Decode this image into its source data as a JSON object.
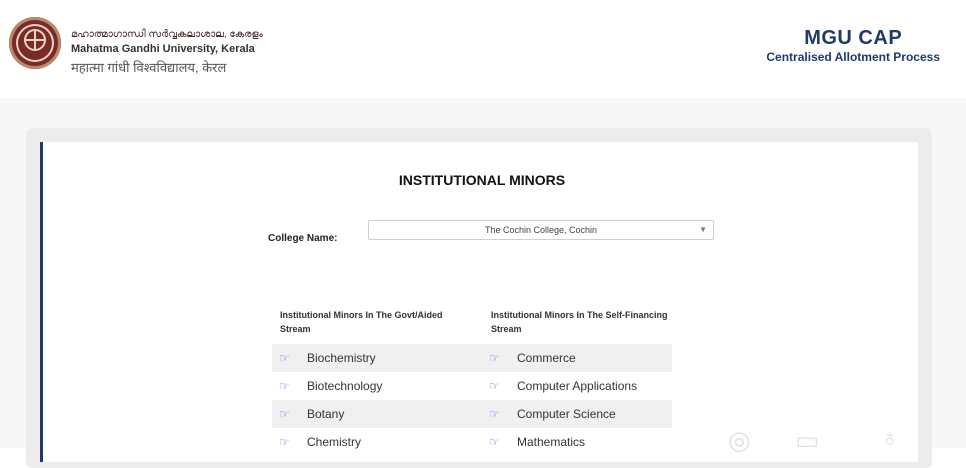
{
  "header": {
    "university_malayalam": "മഹാത്മാഗാന്ധി സർവ്വകലാശാല, കേരളം",
    "university_english": "Mahatma Gandhi University, Kerala",
    "university_hindi": "महात्मा गांधी विश्वविद्यालय, केरल",
    "brand_title": "MGU CAP",
    "brand_subtitle": "Centralised Allotment Process"
  },
  "main": {
    "title": "INSTITUTIONAL MINORS",
    "college_label": "College Name:",
    "college_value": "The Cochin College, Cochin",
    "col_govt_heading": "Institutional Minors In The Govt/Aided Stream",
    "col_sf_heading": "Institutional Minors In The Self-Financing Stream",
    "govt_minors": [
      "Biochemistry",
      "Biotechnology",
      "Botany",
      "Chemistry"
    ],
    "sf_minors": [
      "Commerce",
      "Computer Applications",
      "Computer Science",
      "Mathematics"
    ]
  },
  "icons": {
    "list_bullet": "hand-pointing-right-icon",
    "logo": "university-emblem"
  },
  "colors": {
    "brand_navy": "#1d3a6b",
    "bullet_blue": "#4a7bd0",
    "row_shade": "#f0f0f0"
  }
}
